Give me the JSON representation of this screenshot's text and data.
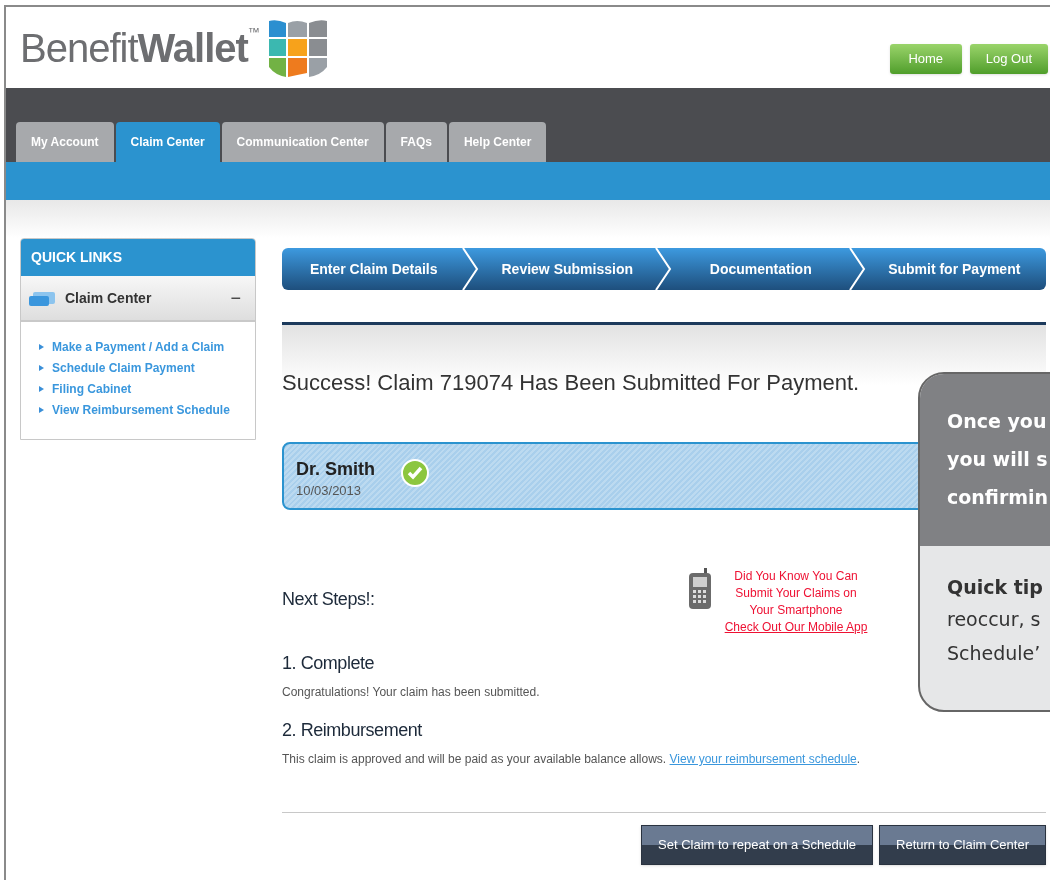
{
  "logo": {
    "text": "Benefit**Wallet**$^{™}$"
  },
  "header_buttons": [
    "Home",
    "Log Out"
  ],
  "tabs": [
    {
      "label": "My Account",
      "selected": false
    },
    {
      "label": "Claim Center",
      "selected": true
    },
    {
      "label": "Communication Center",
      "selected": false
    },
    {
      "label": "FAQs",
      "selected": false
    },
    {
      "label": "Help Center",
      "selected": false
    }
  ],
  "sidebar": {
    "title": "QUICK LINKS",
    "section": {
      "label": "Claim Center",
      "toggle": "−"
    },
    "items": [
      "Make a Payment / Add a Claim",
      "Schedule Claim Payment",
      "Filing Cabinet",
      "View Reimbursement Schedule"
    ]
  },
  "steps": [
    "Enter Claim Details",
    "Review Submission",
    "Documentation",
    "Submit for Payment"
  ],
  "success_message": "Success! Claim 719074 Has Been Submitted For Payment.",
  "claim": {
    "provider": "Dr. Smith",
    "date": "10/03/2013",
    "approved": true
  },
  "tooltip": {
    "top_lines": [
      "Once you",
      "you will s",
      "confirmin"
    ],
    "tip_title": "Quick tip",
    "bottom_lines": [
      "reoccur, s",
      "Schedule’"
    ]
  },
  "next_steps_title": "Next Steps!:",
  "promo": {
    "lines": [
      "Did You Know You Can",
      "Submit Your Claims on",
      "Your Smartphone"
    ],
    "link": "Check Out Our Mobile App"
  },
  "next_steps": [
    {
      "heading": "1. Complete",
      "text": "Congratulations! Your claim has been submitted."
    },
    {
      "heading": "2. Reimbursement",
      "text": "This claim is approved and will be paid as your available balance allows.",
      "link": "View your reimbursement schedule",
      "suffix": "."
    }
  ],
  "buttons": [
    "Set Claim to repeat on a Schedule",
    "Return to Claim Center"
  ]
}
